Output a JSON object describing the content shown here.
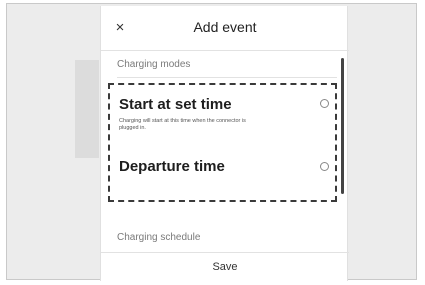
{
  "header": {
    "close_label": "×",
    "title": "Add event"
  },
  "charging_modes": {
    "label": "Charging modes",
    "options": [
      {
        "title": "Start at set time",
        "description": "Charging will start at this time when the connector is plugged in.",
        "selected": false
      },
      {
        "title": "Departure time",
        "selected": false
      }
    ]
  },
  "charging_schedule": {
    "label": "Charging schedule"
  },
  "footer": {
    "save_label": "Save"
  },
  "icons": {
    "close": "close-icon",
    "radio": "radio-unselected-icon"
  }
}
